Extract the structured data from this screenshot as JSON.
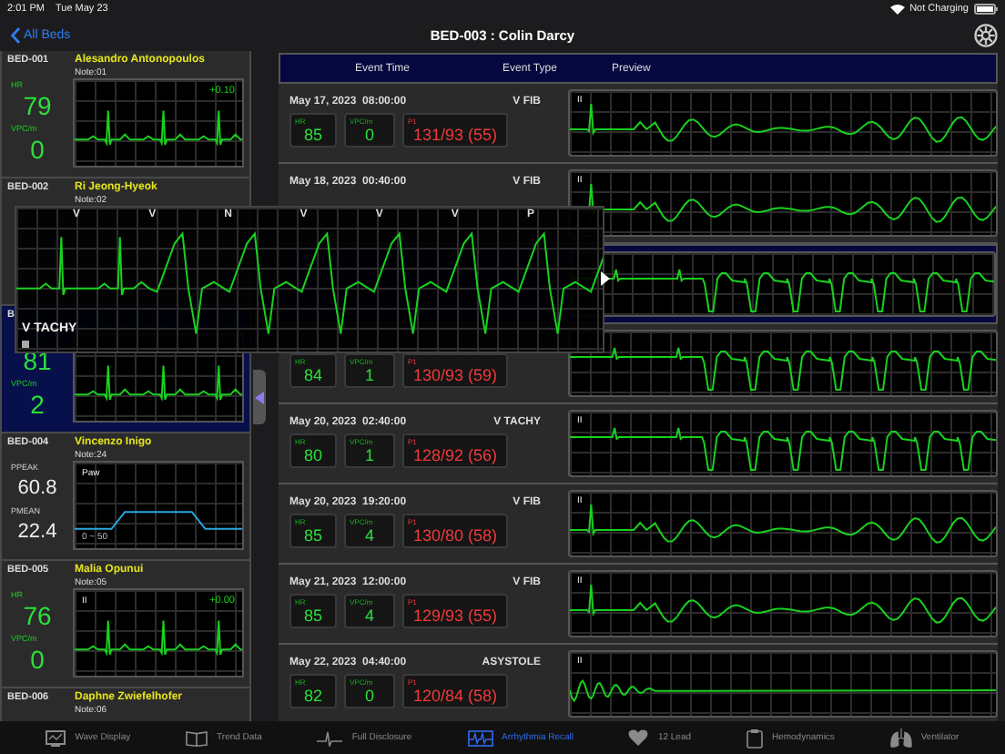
{
  "status_bar": {
    "time": "2:01 PM",
    "date": "Tue May 23",
    "charging": "Not Charging"
  },
  "nav": {
    "back": "All Beds",
    "title": "BED-003 : Colin Darcy"
  },
  "beds": [
    {
      "id": "BED-001",
      "name": "Alesandro Antonopoulos",
      "note": "Note:01",
      "kind": "ecg",
      "selected": false,
      "metrics": [
        {
          "label": "HR",
          "value": "79"
        },
        {
          "label": "VPC/m",
          "value": "0"
        }
      ],
      "offset": "+0.10"
    },
    {
      "id": "BED-002",
      "name": "Ri Jeong-Hyeok",
      "note": "Note:02",
      "selected": false
    },
    {
      "id": "B",
      "kind": "ecg",
      "selected": true,
      "metrics": [
        {
          "value": "81"
        },
        {
          "label": "VPC/m",
          "value": "2"
        }
      ]
    },
    {
      "id": "BED-004",
      "name": "Vincenzo Inigo",
      "note": "Note:24",
      "kind": "vent",
      "selected": false,
      "metrics": [
        {
          "label": "PPEAK",
          "value": "60.8"
        },
        {
          "label": "PMEAN",
          "value": "22.4"
        }
      ],
      "wave_label": "Paw",
      "scale": "0 ~ 50"
    },
    {
      "id": "BED-005",
      "name": "Malia Opunui",
      "note": "Note:05",
      "kind": "ecg",
      "selected": false,
      "metrics": [
        {
          "label": "HR",
          "value": "76"
        },
        {
          "label": "VPC/m",
          "value": "0"
        }
      ],
      "lead": "II",
      "offset": "+0.00"
    },
    {
      "id": "BED-006",
      "name": "Daphne Zwiefelhofer",
      "note": "Note:06",
      "selected": false
    }
  ],
  "table": {
    "columns": [
      "Event Time",
      "Event Type",
      "Preview"
    ]
  },
  "events": [
    {
      "time": "May 17, 2023  08:00:00",
      "type": "V FIB",
      "selected": false,
      "kind": "vfib",
      "lead": "II",
      "vitals": [
        {
          "label": "HR",
          "value": "85"
        },
        {
          "label": "VPC/m",
          "value": "0"
        },
        {
          "label": "P1",
          "value": "131/93 (55)"
        }
      ]
    },
    {
      "time": "May 18, 2023  00:40:00",
      "type": "V FIB",
      "selected": false,
      "kind": "vfib",
      "lead": "II"
    },
    {
      "selected": true,
      "kind": "vtachy"
    },
    {
      "selected": false,
      "kind": "vtachy",
      "vitals": [
        {
          "label": "HR",
          "value": "84"
        },
        {
          "label": "VPC/m",
          "value": "1"
        },
        {
          "label": "P1",
          "value": "130/93 (59)"
        }
      ]
    },
    {
      "time": "May 20, 2023  02:40:00",
      "type": "V TACHY",
      "selected": false,
      "kind": "vtachy",
      "lead": "II",
      "vitals": [
        {
          "label": "HR",
          "value": "80"
        },
        {
          "label": "VPC/m",
          "value": "1"
        },
        {
          "label": "P1",
          "value": "128/92 (56)"
        }
      ]
    },
    {
      "time": "May 20, 2023  19:20:00",
      "type": "V FIB",
      "selected": false,
      "kind": "vfib",
      "lead": "II",
      "vitals": [
        {
          "label": "HR",
          "value": "85"
        },
        {
          "label": "VPC/m",
          "value": "4"
        },
        {
          "label": "P1",
          "value": "130/80 (58)"
        }
      ]
    },
    {
      "time": "May 21, 2023  12:00:00",
      "type": "V FIB",
      "selected": false,
      "kind": "vfib",
      "lead": "II",
      "vitals": [
        {
          "label": "HR",
          "value": "85"
        },
        {
          "label": "VPC/m",
          "value": "4"
        },
        {
          "label": "P1",
          "value": "129/93 (55)"
        }
      ]
    },
    {
      "time": "May 22, 2023  04:40:00",
      "type": "ASYSTOLE",
      "selected": false,
      "kind": "asystole",
      "lead": "II",
      "vitals": [
        {
          "label": "HR",
          "value": "82"
        },
        {
          "label": "VPC/m",
          "value": "0"
        },
        {
          "label": "P1",
          "value": "120/84 (58)"
        }
      ]
    }
  ],
  "popup": {
    "beats": [
      "V",
      "V",
      "N",
      "V",
      "V",
      "V",
      "P"
    ],
    "title": "V TACHY"
  },
  "tabs": [
    {
      "label": "Wave Display",
      "kind": "monitor",
      "selected": false
    },
    {
      "label": "Trend Data",
      "kind": "book",
      "selected": false
    },
    {
      "label": "Full Disclosure",
      "kind": "pulse",
      "selected": false
    },
    {
      "label": "Arrhythmia Recall",
      "kind": "strip",
      "selected": true
    },
    {
      "label": "12 Lead",
      "kind": "heart",
      "selected": false
    },
    {
      "label": "Hemodynamics",
      "kind": "clipboard",
      "selected": false
    },
    {
      "label": "Ventilator",
      "kind": "lungs",
      "selected": false
    }
  ]
}
